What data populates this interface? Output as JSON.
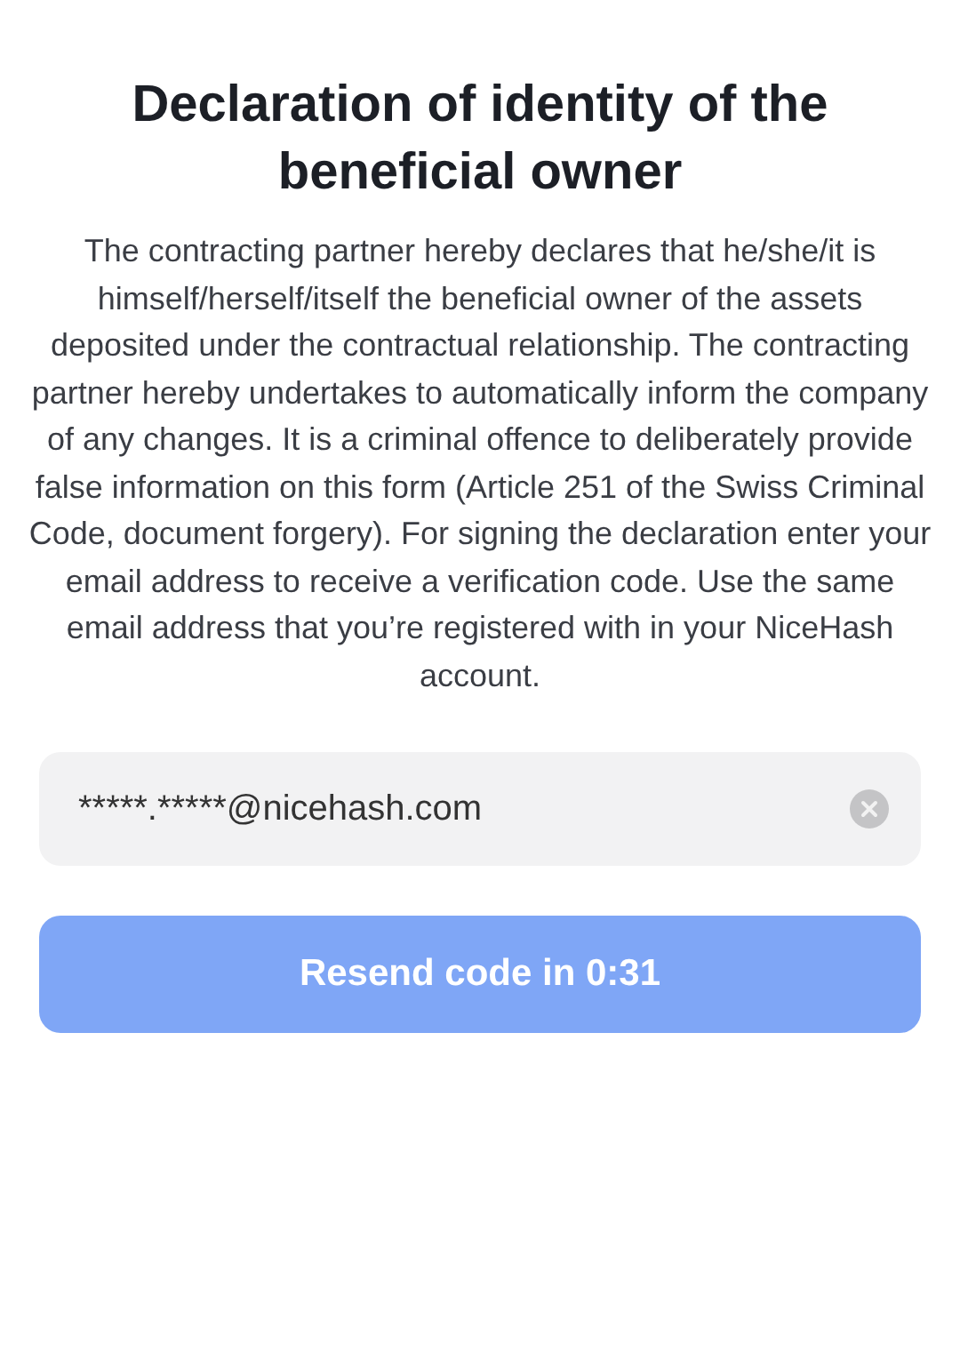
{
  "title": "Declaration of identity of the beneficial owner",
  "description": "The contracting partner hereby declares that he/she/it is himself/herself/itself the beneficial owner of the assets deposited under the contractual relationship. The contracting partner hereby undertakes to automatically inform the company of any changes. It is a criminal offence to deliberately provide false information on this form (Article 251 of the Swiss Criminal Code, document forgery). For signing the declaration enter your email address to receive a verification code. Use the same email address that you’re registered with in your NiceHash account.",
  "email_field": {
    "value": "*****.*****@nicehash.com"
  },
  "resend_button": {
    "label": "Resend code in 0:31",
    "disabled": true
  }
}
